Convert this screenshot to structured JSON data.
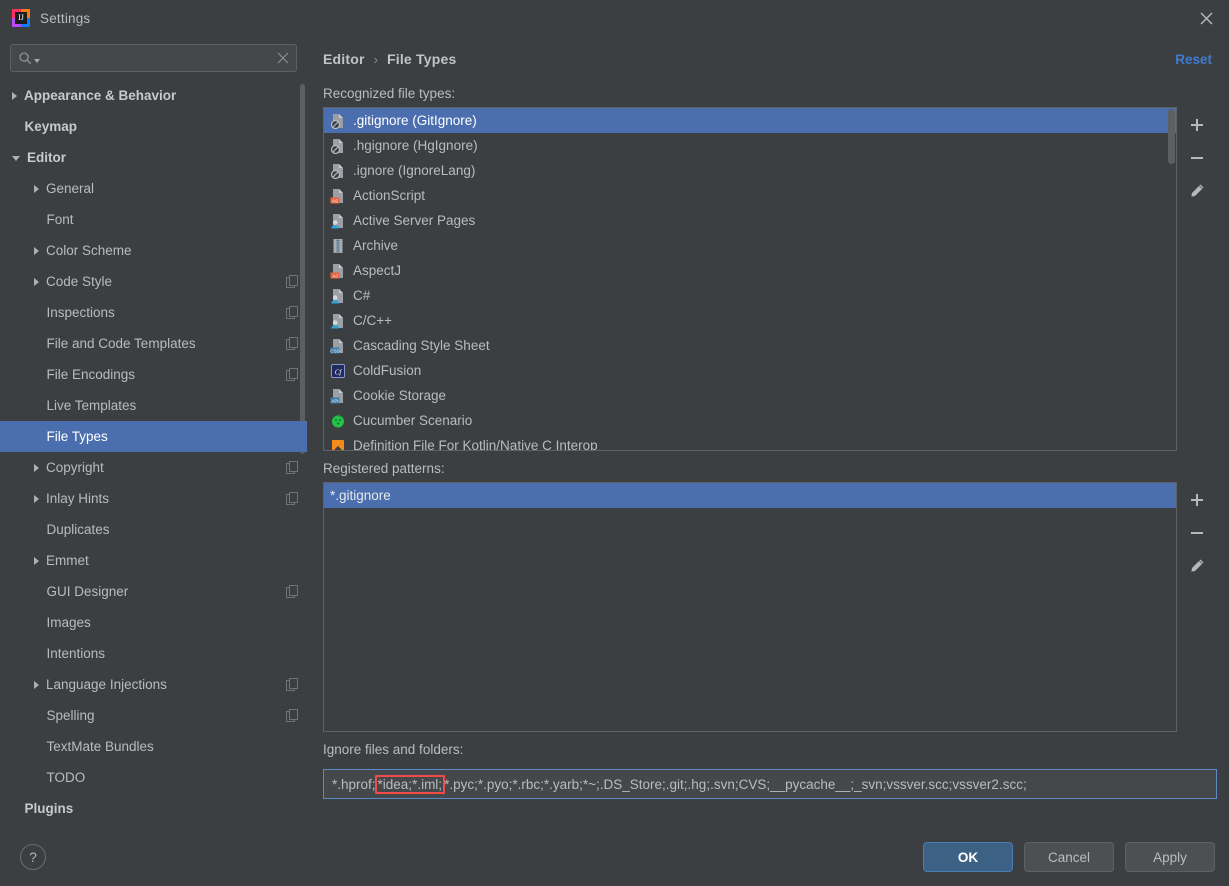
{
  "window": {
    "title": "Settings",
    "app_icon": "intellij-idea-icon",
    "close_icon": "close-icon"
  },
  "search": {
    "value": "",
    "placeholder": "",
    "icon": "search-icon",
    "clear_icon": "clear-icon"
  },
  "sidebar": {
    "items": [
      {
        "label": "Appearance & Behavior",
        "arrow": "right",
        "indent": 0,
        "bold": true,
        "badge": false,
        "selected": false
      },
      {
        "label": "Keymap",
        "arrow": "none",
        "indent": 0,
        "bold": true,
        "badge": false,
        "selected": false
      },
      {
        "label": "Editor",
        "arrow": "down",
        "indent": 0,
        "bold": true,
        "badge": false,
        "selected": false
      },
      {
        "label": "General",
        "arrow": "right",
        "indent": 1,
        "bold": false,
        "badge": false,
        "selected": false
      },
      {
        "label": "Font",
        "arrow": "none",
        "indent": 1,
        "bold": false,
        "badge": false,
        "selected": false
      },
      {
        "label": "Color Scheme",
        "arrow": "right",
        "indent": 1,
        "bold": false,
        "badge": false,
        "selected": false
      },
      {
        "label": "Code Style",
        "arrow": "right",
        "indent": 1,
        "bold": false,
        "badge": true,
        "selected": false
      },
      {
        "label": "Inspections",
        "arrow": "none",
        "indent": 1,
        "bold": false,
        "badge": true,
        "selected": false
      },
      {
        "label": "File and Code Templates",
        "arrow": "none",
        "indent": 1,
        "bold": false,
        "badge": true,
        "selected": false
      },
      {
        "label": "File Encodings",
        "arrow": "none",
        "indent": 1,
        "bold": false,
        "badge": true,
        "selected": false
      },
      {
        "label": "Live Templates",
        "arrow": "none",
        "indent": 1,
        "bold": false,
        "badge": false,
        "selected": false
      },
      {
        "label": "File Types",
        "arrow": "none",
        "indent": 1,
        "bold": false,
        "badge": false,
        "selected": true
      },
      {
        "label": "Copyright",
        "arrow": "right",
        "indent": 1,
        "bold": false,
        "badge": true,
        "selected": false
      },
      {
        "label": "Inlay Hints",
        "arrow": "right",
        "indent": 1,
        "bold": false,
        "badge": true,
        "selected": false
      },
      {
        "label": "Duplicates",
        "arrow": "none",
        "indent": 1,
        "bold": false,
        "badge": false,
        "selected": false
      },
      {
        "label": "Emmet",
        "arrow": "right",
        "indent": 1,
        "bold": false,
        "badge": false,
        "selected": false
      },
      {
        "label": "GUI Designer",
        "arrow": "none",
        "indent": 1,
        "bold": false,
        "badge": true,
        "selected": false
      },
      {
        "label": "Images",
        "arrow": "none",
        "indent": 1,
        "bold": false,
        "badge": false,
        "selected": false
      },
      {
        "label": "Intentions",
        "arrow": "none",
        "indent": 1,
        "bold": false,
        "badge": false,
        "selected": false
      },
      {
        "label": "Language Injections",
        "arrow": "right",
        "indent": 1,
        "bold": false,
        "badge": true,
        "selected": false
      },
      {
        "label": "Spelling",
        "arrow": "none",
        "indent": 1,
        "bold": false,
        "badge": true,
        "selected": false
      },
      {
        "label": "TextMate Bundles",
        "arrow": "none",
        "indent": 1,
        "bold": false,
        "badge": false,
        "selected": false
      },
      {
        "label": "TODO",
        "arrow": "none",
        "indent": 1,
        "bold": false,
        "badge": false,
        "selected": false
      },
      {
        "label": "Plugins",
        "arrow": "none",
        "indent": 0,
        "bold": true,
        "badge": false,
        "selected": false
      }
    ]
  },
  "header": {
    "breadcrumb": [
      "Editor",
      "File Types"
    ],
    "separator": "›",
    "reset_label": "Reset"
  },
  "recognized": {
    "label": "Recognized file types:",
    "items": [
      {
        "label": ".gitignore (GitIgnore)",
        "icon": "ignore-file-icon",
        "selected": true
      },
      {
        "label": ".hgignore (HgIgnore)",
        "icon": "ignore-file-icon",
        "selected": false
      },
      {
        "label": ".ignore (IgnoreLang)",
        "icon": "ignore-file-icon",
        "selected": false
      },
      {
        "label": "ActionScript",
        "icon": "actionscript-file-icon",
        "selected": false
      },
      {
        "label": "Active Server Pages",
        "icon": "asp-file-icon",
        "selected": false
      },
      {
        "label": "Archive",
        "icon": "archive-file-icon",
        "selected": false
      },
      {
        "label": "AspectJ",
        "icon": "aspectj-file-icon",
        "selected": false
      },
      {
        "label": "C#",
        "icon": "asp-file-icon",
        "selected": false
      },
      {
        "label": "C/C++",
        "icon": "asp-file-icon",
        "selected": false
      },
      {
        "label": "Cascading Style Sheet",
        "icon": "css-file-icon",
        "selected": false
      },
      {
        "label": "ColdFusion",
        "icon": "coldfusion-file-icon",
        "selected": false
      },
      {
        "label": "Cookie Storage",
        "icon": "api-file-icon",
        "selected": false
      },
      {
        "label": "Cucumber Scenario",
        "icon": "cucumber-file-icon",
        "selected": false
      },
      {
        "label": "Definition File For Kotlin/Native C Interop",
        "icon": "kotlin-native-file-icon",
        "selected": false
      }
    ],
    "tools": [
      {
        "name": "add-file-type-button",
        "icon": "plus-icon"
      },
      {
        "name": "remove-file-type-button",
        "icon": "minus-icon"
      },
      {
        "name": "edit-file-type-button",
        "icon": "pencil-icon"
      }
    ]
  },
  "patterns": {
    "label": "Registered patterns:",
    "items": [
      {
        "label": "*.gitignore",
        "selected": true
      }
    ],
    "tools": [
      {
        "name": "add-pattern-button",
        "icon": "plus-icon"
      },
      {
        "name": "remove-pattern-button",
        "icon": "minus-icon"
      },
      {
        "name": "edit-pattern-button",
        "icon": "pencil-icon"
      }
    ]
  },
  "ignore": {
    "label": "Ignore files and folders:",
    "prefix": "*.hprof;",
    "highlighted": "*idea;*.iml;",
    "suffix": "*.pyc;*.pyo;*.rbc;*.yarb;*~;.DS_Store;.git;.hg;.svn;CVS;__pycache__;_svn;vssver.scc;vssver2.scc;",
    "full_value": "*.hprof;*idea;*.iml;*.pyc;*.pyo;*.rbc;*.yarb;*~;.DS_Store;.git;.hg;.svn;CVS;__pycache__;_svn;vssver.scc;vssver2.scc;",
    "highlight_color": "#f04a4a"
  },
  "footer": {
    "help_label": "?",
    "ok_label": "OK",
    "cancel_label": "Cancel",
    "apply_label": "Apply"
  },
  "colors": {
    "background": "#3c3f41",
    "selection": "#4b6eaf",
    "link": "#3d7cd1",
    "text": "#bbbbbb",
    "primary_button": "#3d6185"
  }
}
